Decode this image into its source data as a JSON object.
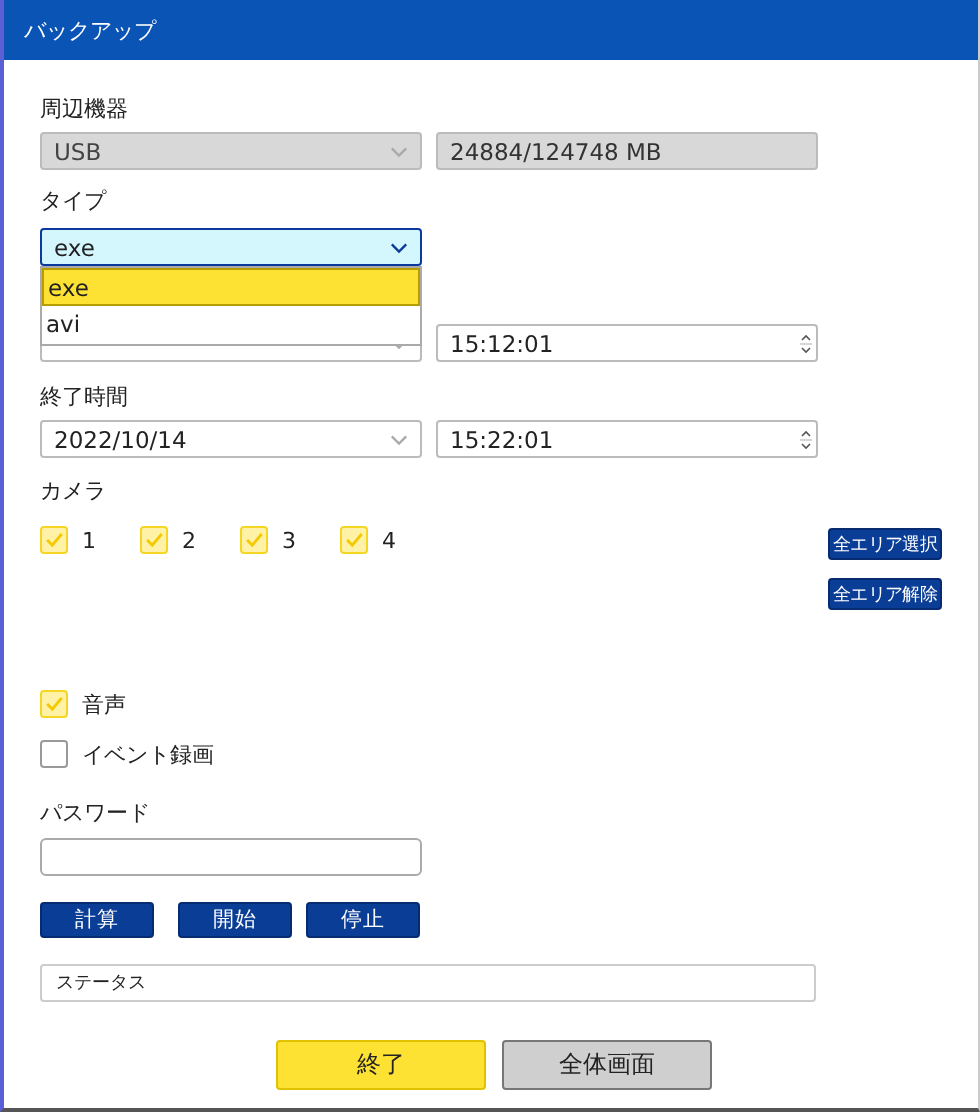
{
  "window": {
    "title": "バックアップ"
  },
  "device": {
    "label": "周辺機器",
    "value": "USB",
    "disabled": true,
    "capacity": "24884/124748 MB"
  },
  "type": {
    "label": "タイプ",
    "value": "exe",
    "expanded": true,
    "options": [
      {
        "label": "exe",
        "selected": true
      },
      {
        "label": "avi",
        "selected": false
      }
    ]
  },
  "start": {
    "time": "15:12:01"
  },
  "end": {
    "label": "終了時間",
    "date": "2022/10/14",
    "time": "15:22:01"
  },
  "camera": {
    "label": "カメラ",
    "channels": [
      {
        "label": "1",
        "checked": true
      },
      {
        "label": "2",
        "checked": true
      },
      {
        "label": "3",
        "checked": true
      },
      {
        "label": "4",
        "checked": true
      }
    ],
    "buttons": [
      "全エリア選択",
      "全エリア解除"
    ]
  },
  "options": [
    {
      "label": "音声",
      "checked": true
    },
    {
      "label": "イベント録画",
      "checked": false
    }
  ],
  "password": {
    "label": "パスワード"
  },
  "actions": [
    "計算",
    "開始",
    "停止"
  ],
  "status": {
    "text": "ステータス"
  },
  "footer": [
    {
      "label": "終了",
      "kind": "primary"
    },
    {
      "label": "全体画面",
      "kind": "secondary"
    }
  ]
}
